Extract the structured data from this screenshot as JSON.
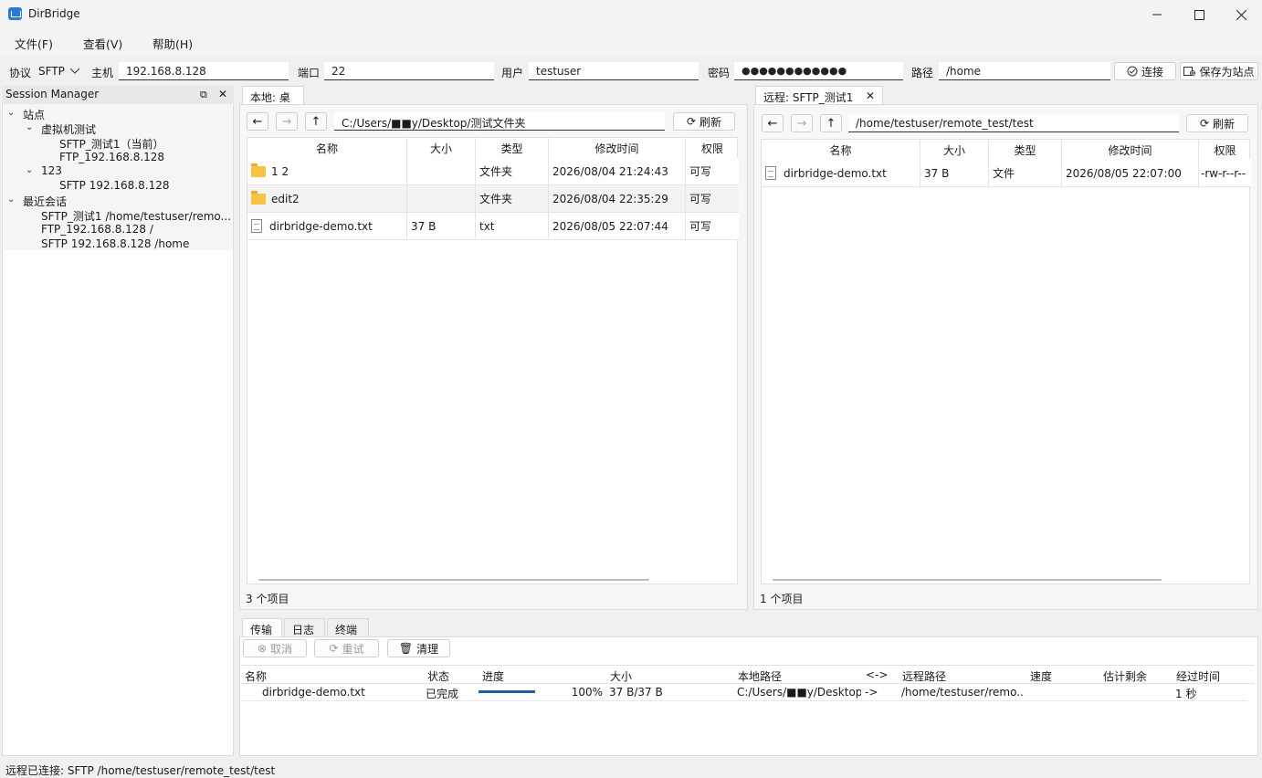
{
  "window": {
    "title": "DirBridge"
  },
  "menu": [
    {
      "label": "文件(F)"
    },
    {
      "label": "查看(V)"
    },
    {
      "label": "帮助(H)"
    }
  ],
  "connection": {
    "protocol_label": "协议",
    "protocol_value": "SFTP",
    "host_label": "主机",
    "host_value": "192.168.8.128",
    "port_label": "端口",
    "port_value": "22",
    "user_label": "用户",
    "user_value": "testuser",
    "password_label": "密码",
    "password_value": "●●●●●●●●●●●●",
    "path_label": "路径",
    "path_value": "/home",
    "connect_label": "连接",
    "save_label": "保存为站点"
  },
  "session_manager": {
    "title": "Session Manager",
    "sites_label": "站点",
    "group1": {
      "label": "虚拟机测试",
      "items": [
        "SFTP_测试1（当前）",
        "FTP_192.168.8.128"
      ]
    },
    "group2": {
      "label": "123",
      "items": [
        "SFTP 192.168.8.128"
      ]
    },
    "recent_label": "最近会话",
    "recent": [
      "SFTP_测试1  /home/testuser/remo...",
      "FTP_192.168.8.128  /",
      "SFTP 192.168.8.128  /home"
    ]
  },
  "local": {
    "tab": "本地: 桌面",
    "path": "C:/Users/■■y/Desktop/测试文件夹",
    "refresh": "刷新",
    "columns": [
      "名称",
      "大小",
      "类型",
      "修改时间",
      "权限"
    ],
    "rows": [
      {
        "icon": "folder",
        "name": "1 2",
        "size": "",
        "type": "文件夹",
        "mtime": "2026/08/04 21:24:43",
        "perm": "可写"
      },
      {
        "icon": "folder",
        "name": "edit2",
        "size": "",
        "type": "文件夹",
        "mtime": "2026/08/04 22:35:29",
        "perm": "可写"
      },
      {
        "icon": "file",
        "name": "dirbridge-demo.txt",
        "size": "37 B",
        "type": "txt",
        "mtime": "2026/08/05 22:07:44",
        "perm": "可写"
      }
    ],
    "count": "3 个项目"
  },
  "remote": {
    "tab": "远程: SFTP_测试1",
    "path": "/home/testuser/remote_test/test",
    "refresh": "刷新",
    "columns": [
      "名称",
      "大小",
      "类型",
      "修改时间",
      "权限"
    ],
    "rows": [
      {
        "icon": "file",
        "name": "dirbridge-demo.txt",
        "size": "37 B",
        "type": "文件",
        "mtime": "2026/08/05 22:07:00",
        "perm": "-rw-r--r--"
      }
    ],
    "count": "1 个项目"
  },
  "bottom": {
    "tabs": [
      "传输",
      "日志",
      "终端"
    ],
    "cancel": "取消",
    "retry": "重试",
    "clear": "清理",
    "columns": [
      "名称",
      "状态",
      "进度",
      "大小",
      "本地路径",
      "<->",
      "远程路径",
      "速度",
      "估计剩余",
      "经过时间"
    ],
    "transfer": {
      "name": "dirbridge-demo.txt",
      "status": "已完成",
      "progress": 1.0,
      "progress_text": "100%",
      "size": "37 B/37 B",
      "local_path": "C:/Users/■■y/Desktop/...",
      "direction": "->",
      "remote_path": "/home/testuser/remo...",
      "speed": "",
      "eta": "",
      "elapsed": "1 秒"
    }
  },
  "status": "远程已连接: SFTP /home/testuser/remote_test/test",
  "colors": {
    "accent": "#2b7bd6",
    "progress": "#1f5fa8",
    "folder": "#f6c343"
  }
}
